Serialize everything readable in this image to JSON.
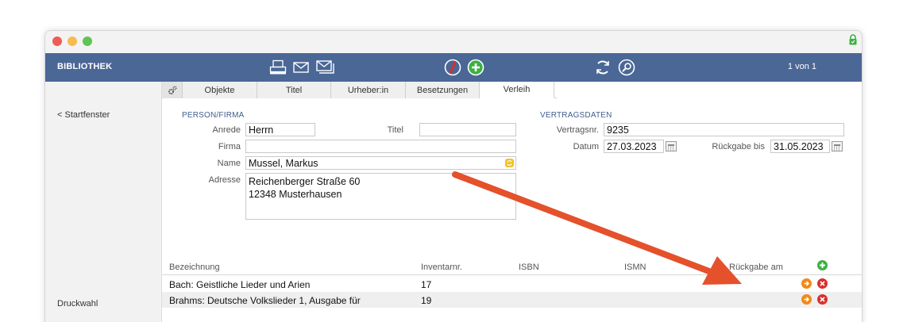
{
  "toolbar": {
    "title": "BIBLIOTHEK",
    "record_count": "1 von 1"
  },
  "nav": {
    "back": "< Startfenster",
    "print": "Druckwahl"
  },
  "tabs": [
    {
      "label": "Objekte"
    },
    {
      "label": "Titel"
    },
    {
      "label": "Urheber:in"
    },
    {
      "label": "Besetzungen"
    },
    {
      "label": "Verleih"
    }
  ],
  "person": {
    "section_title": "PERSON/FIRMA",
    "anrede_label": "Anrede",
    "anrede_value": "Herrn",
    "titel_label": "Titel",
    "titel_value": "",
    "firma_label": "Firma",
    "firma_value": "",
    "name_label": "Name",
    "name_value": "Mussel, Markus",
    "adresse_label": "Adresse",
    "adresse_line1": "Reichenberger Straße 60",
    "adresse_line2": "12348 Musterhausen"
  },
  "contract": {
    "section_title": "VERTRAGSDATEN",
    "number_label": "Vertragsnr.",
    "number_value": "9235",
    "date_label": "Datum",
    "date_value": "27.03.2023",
    "return_label": "Rückgabe bis",
    "return_value": "31.05.2023"
  },
  "table": {
    "headers": {
      "bezeichnung": "Bezeichnung",
      "inventar": "Inventarnr.",
      "isbn": "ISBN",
      "ismn": "ISMN",
      "rueckgabe": "Rückgabe am"
    },
    "rows": [
      {
        "bezeichnung": "Bach: Geistliche Lieder und Arien",
        "inventar": "17",
        "isbn": "",
        "ismn": "",
        "rueckgabe": ""
      },
      {
        "bezeichnung": "Brahms: Deutsche Volkslieder 1, Ausgabe für",
        "inventar": "19",
        "isbn": "",
        "ismn": "",
        "rueckgabe": ""
      }
    ]
  },
  "colors": {
    "toolbar": "#4a6796",
    "section_title": "#3f5f8f",
    "add": "#3cb044",
    "goto": "#f08a1c",
    "delete": "#d9302c",
    "annotation_arrow": "#e4512b"
  },
  "icons": [
    "printer-icon",
    "mail-icon",
    "mail-stack-icon",
    "delete-record-icon",
    "new-record-icon",
    "refresh-icon",
    "search-icon",
    "gear-icon",
    "lock-icon",
    "calendar-icon",
    "lookup-icon",
    "add-row-icon",
    "goto-icon",
    "remove-row-icon"
  ]
}
